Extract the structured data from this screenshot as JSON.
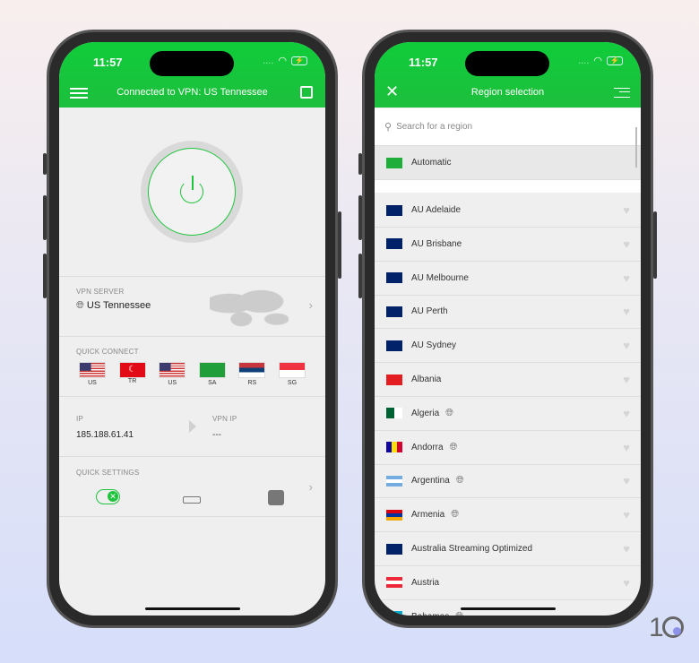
{
  "status_bar": {
    "time": "11:57",
    "signal": "....",
    "wifi_icon": "wifi-icon",
    "battery_icon": "battery-charging-icon"
  },
  "left": {
    "header_title": "Connected to VPN: US Tennessee",
    "vpn_server": {
      "label": "VPN SERVER",
      "value": "US Tennessee"
    },
    "quick_connect": {
      "label": "QUICK CONNECT",
      "items": [
        {
          "code": "US"
        },
        {
          "code": "TR"
        },
        {
          "code": "US"
        },
        {
          "code": "SA"
        },
        {
          "code": "RS"
        },
        {
          "code": "SG"
        }
      ]
    },
    "ip": {
      "label": "IP",
      "value": "185.188.61.41"
    },
    "vpn_ip": {
      "label": "VPN IP",
      "value": "---"
    },
    "quick_settings": {
      "label": "QUICK SETTINGS"
    },
    "accent": "#1ec43c"
  },
  "right": {
    "header_title": "Region selection",
    "search_placeholder": "Search for a region",
    "automatic": "Automatic",
    "regions": [
      {
        "name": "AU Adelaide",
        "flag": "AU",
        "globe": false
      },
      {
        "name": "AU Brisbane",
        "flag": "AU",
        "globe": false
      },
      {
        "name": "AU Melbourne",
        "flag": "AU",
        "globe": false
      },
      {
        "name": "AU Perth",
        "flag": "AU",
        "globe": false
      },
      {
        "name": "AU Sydney",
        "flag": "AU",
        "globe": false
      },
      {
        "name": "Albania",
        "flag": "AL",
        "globe": false
      },
      {
        "name": "Algeria",
        "flag": "DZ",
        "globe": true
      },
      {
        "name": "Andorra",
        "flag": "AD",
        "globe": true
      },
      {
        "name": "Argentina",
        "flag": "AR",
        "globe": true
      },
      {
        "name": "Armenia",
        "flag": "AM",
        "globe": true
      },
      {
        "name": "Australia Streaming Optimized",
        "flag": "AU",
        "globe": false
      },
      {
        "name": "Austria",
        "flag": "AT",
        "globe": false
      },
      {
        "name": "Bahamas",
        "flag": "BS",
        "globe": true
      }
    ]
  },
  "watermark": "10"
}
